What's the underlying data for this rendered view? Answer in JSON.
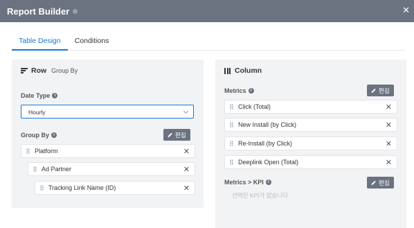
{
  "window": {
    "title": "Report Builder",
    "close_icon": "close-icon"
  },
  "tabs": [
    {
      "label": "Table Design",
      "active": true
    },
    {
      "label": "Conditions",
      "active": false
    }
  ],
  "row_section": {
    "title": "Row",
    "subtitle": "Group By",
    "date_type": {
      "label": "Date Type",
      "value": "Hourly"
    },
    "group_by": {
      "label": "Group By",
      "edit_label": "편집",
      "items": [
        "Platform",
        "Ad Partner",
        "Tracking Link Name (ID)"
      ]
    }
  },
  "column_section": {
    "title": "Column",
    "metrics": {
      "label": "Metrics",
      "edit_label": "편집",
      "items": [
        "Click (Total)",
        "New Install (by Click)",
        "Re-Install (by Click)",
        "Deeplink Open (Total)"
      ]
    },
    "kpi": {
      "label": "Metrics > KPI",
      "edit_label": "편집",
      "empty_message": "선택된 KPI가 없습니다."
    }
  },
  "colors": {
    "accent": "#1976d2",
    "header": "#6b7280",
    "panel": "#f2f3f5"
  }
}
